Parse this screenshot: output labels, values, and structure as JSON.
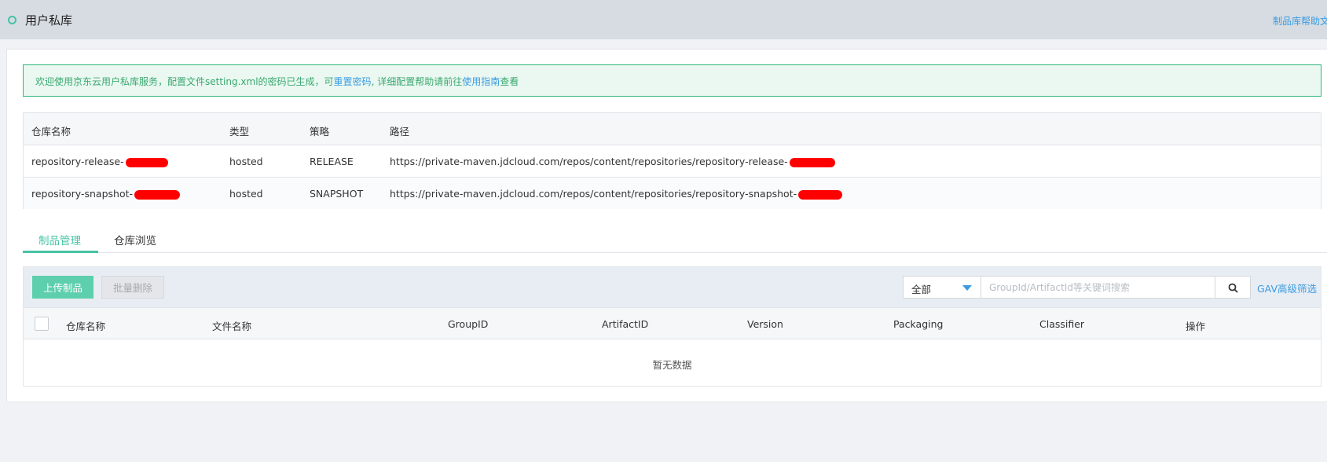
{
  "header": {
    "title": "用户私库",
    "help_link": "制品库帮助文"
  },
  "notice": {
    "text_before": "欢迎使用京东云用户私库服务，配置文件setting.xml的密码已生成，可",
    "reset_link": "重置密码",
    "text_middle": ", 详细配置帮助请前往",
    "guide_link": "使用指南",
    "text_after": "查看"
  },
  "repo_table": {
    "headers": {
      "name": "仓库名称",
      "type": "类型",
      "policy": "策略",
      "path": "路径"
    },
    "rows": [
      {
        "name": "repository-release-",
        "type": "hosted",
        "policy": "RELEASE",
        "path": "https://private-maven.jdcloud.com/repos/content/repositories/repository-release-"
      },
      {
        "name": "repository-snapshot-",
        "type": "hosted",
        "policy": "SNAPSHOT",
        "path": "https://private-maven.jdcloud.com/repos/content/repositories/repository-snapshot-"
      }
    ]
  },
  "tabs": [
    {
      "label": "制品管理",
      "active": true
    },
    {
      "label": "仓库浏览",
      "active": false
    }
  ],
  "toolbar": {
    "upload_label": "上传制品",
    "bulk_delete_label": "批量删除",
    "filter_selected": "全部",
    "search_placeholder": "GroupId/ArtifactId等关键词搜索",
    "gav_filter_label": "GAV高级筛选"
  },
  "product_table": {
    "headers": {
      "repo": "仓库名称",
      "file": "文件名称",
      "group": "GroupID",
      "artifact": "ArtifactID",
      "version": "Version",
      "packaging": "Packaging",
      "classifier": "Classifier",
      "ops": "操作"
    },
    "empty_text": "暂无数据"
  },
  "colors": {
    "accent": "#46c3a4",
    "link": "#3a9be3",
    "redaction": "#ff0000"
  }
}
